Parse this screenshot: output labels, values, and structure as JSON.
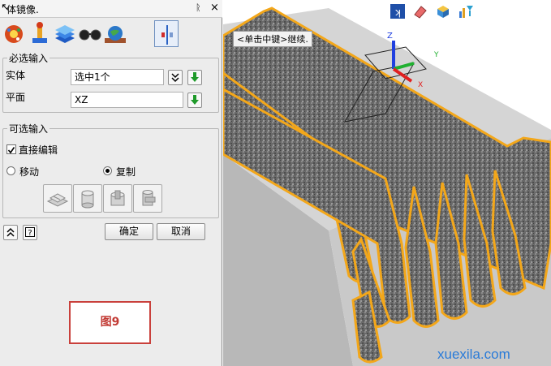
{
  "panel": {
    "title": "体镜像.",
    "pin_glyph": "ᚱ",
    "close_glyph": "×",
    "toolbar_icons": [
      "gear-palette-icon",
      "brush-icon",
      "layers-icon",
      "glasses-icon",
      "globe-icon",
      "mirror-plane-icon"
    ],
    "required_group": {
      "legend": "必选输入",
      "entity_label": "实体",
      "entity_value": "选中1个",
      "plane_label": "平面",
      "plane_value": "XZ"
    },
    "optional_group": {
      "legend": "可选输入",
      "direct_edit_label": "直接编辑",
      "direct_edit_checked": true,
      "move_label": "移动",
      "copy_label": "复制",
      "selected_mode": "copy"
    },
    "buttons": {
      "ok": "确定",
      "cancel": "取消"
    },
    "figure_label": "图9"
  },
  "viewport": {
    "hint": "<单击中键>继续.",
    "axes": [
      "Z",
      "Y",
      "X"
    ],
    "watermark": "xuexila.com",
    "colors": {
      "edge": "#f3a71a",
      "surface": "#6a6a6a",
      "wall": "#bdbdbd",
      "axis_x": "#e02020",
      "axis_y": "#20b030",
      "axis_z": "#2040e0"
    }
  }
}
